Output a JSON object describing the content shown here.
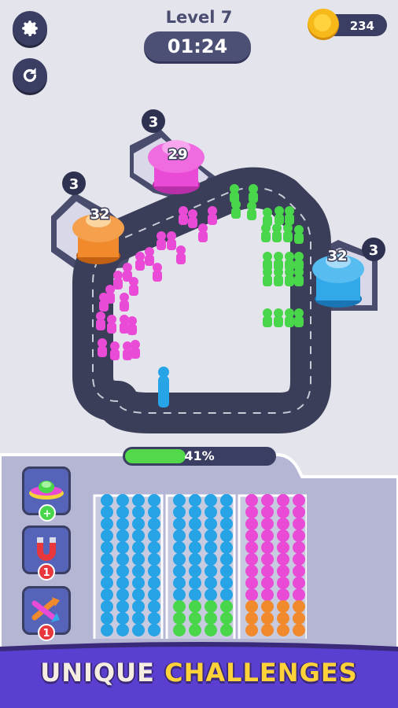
{
  "header": {
    "level_title": "Level 7",
    "timer": "01:24",
    "coin_count": "234"
  },
  "toolbar": {
    "settings_icon": "gear-icon",
    "restart_icon": "restart-icon"
  },
  "board": {
    "stations": [
      {
        "color": "#e94bd6",
        "count": "29",
        "queue": "3"
      },
      {
        "color": "#f08a2c",
        "count": "32",
        "queue": "3"
      },
      {
        "color": "#33a8e8",
        "count": "32",
        "queue": "3"
      }
    ],
    "crowd_colors": {
      "pink": "#e94bd6",
      "green": "#49d64b",
      "blue": "#26a4e6"
    }
  },
  "progress": {
    "value": 0.41,
    "label": "41%"
  },
  "boosters": [
    {
      "icon": "ufo-icon",
      "badge": "+"
    },
    {
      "icon": "magnet-icon",
      "badge": "1"
    },
    {
      "icon": "shuffle-icon",
      "badge": "1"
    }
  ],
  "columns": [
    {
      "top_color": "#26a4e6",
      "bottom_color": "#26a4e6"
    },
    {
      "top_color": "#26a4e6",
      "bottom_color": "#49d64b"
    },
    {
      "top_color": "#e94bd6",
      "bottom_color": "#f08a2c"
    }
  ],
  "banner": {
    "word1": "UNIQUE",
    "word2": "CHALLENGES"
  }
}
